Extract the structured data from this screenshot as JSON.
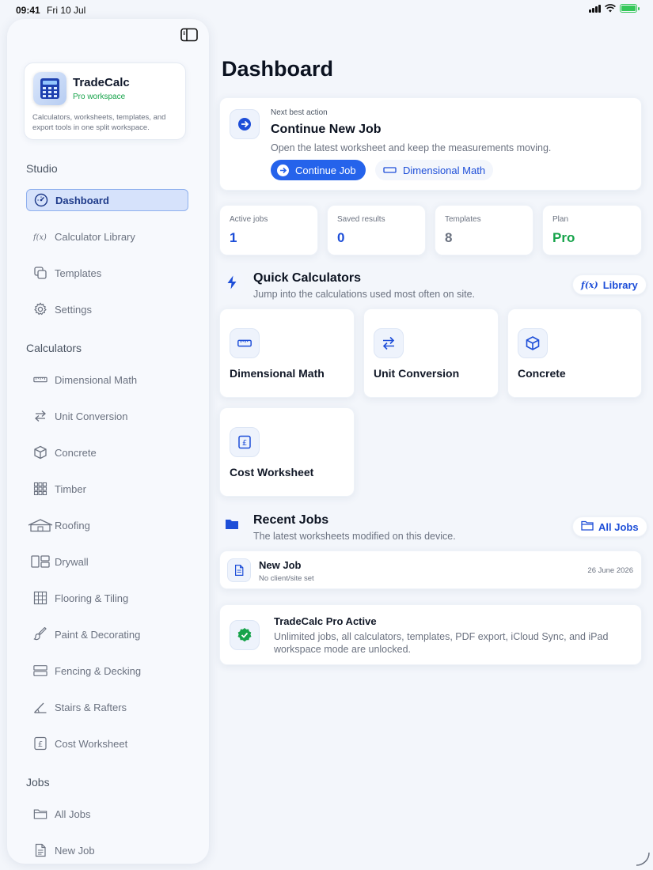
{
  "status": {
    "time": "09:41",
    "date": "Fri 10 Jul"
  },
  "sidebar": {
    "brand": {
      "name": "TradeCalc",
      "subtitle": "Pro workspace",
      "description": "Calculators, worksheets, templates, and export tools in one split workspace."
    },
    "sections": {
      "studio": "Studio",
      "calculators": "Calculators",
      "jobs": "Jobs"
    },
    "studio_items": [
      {
        "label": "Dashboard",
        "icon": "gauge-icon"
      },
      {
        "label": "Calculator Library",
        "icon": "function-icon"
      },
      {
        "label": "Templates",
        "icon": "copy-icon"
      },
      {
        "label": "Settings",
        "icon": "gear-icon"
      }
    ],
    "calculator_items": [
      {
        "label": "Dimensional Math",
        "icon": "ruler-icon"
      },
      {
        "label": "Unit Conversion",
        "icon": "swap-arrows-icon"
      },
      {
        "label": "Concrete",
        "icon": "cube-icon"
      },
      {
        "label": "Timber",
        "icon": "grid-dots-icon"
      },
      {
        "label": "Roofing",
        "icon": "house-icon"
      },
      {
        "label": "Drywall",
        "icon": "panels-icon"
      },
      {
        "label": "Flooring & Tiling",
        "icon": "tiles-icon"
      },
      {
        "label": "Paint & Decorating",
        "icon": "paint-brush-icon"
      },
      {
        "label": "Fencing & Decking",
        "icon": "boards-icon"
      },
      {
        "label": "Stairs & Rafters",
        "icon": "angle-icon"
      },
      {
        "label": "Cost Worksheet",
        "icon": "pound-icon"
      }
    ],
    "job_items": [
      {
        "label": "All Jobs",
        "icon": "folder-icon"
      },
      {
        "label": "New Job",
        "icon": "document-icon"
      }
    ]
  },
  "main": {
    "title": "Dashboard",
    "next_action": {
      "kicker": "Next best action",
      "title": "Continue New Job",
      "description": "Open the latest worksheet and keep the measurements moving.",
      "primary_label": "Continue Job",
      "secondary_label": "Dimensional Math"
    },
    "stats": [
      {
        "label": "Active jobs",
        "value": "1"
      },
      {
        "label": "Saved results",
        "value": "0"
      },
      {
        "label": "Templates",
        "value": "8"
      },
      {
        "label": "Plan",
        "value": "Pro"
      }
    ],
    "quick": {
      "title": "Quick Calculators",
      "subtitle": "Jump into the calculations used most often on site.",
      "library_label": "Library",
      "tiles": [
        {
          "label": "Dimensional Math",
          "icon": "ruler-icon"
        },
        {
          "label": "Unit Conversion",
          "icon": "swap-arrows-icon"
        },
        {
          "label": "Concrete",
          "icon": "cube-icon"
        },
        {
          "label": "Cost Worksheet",
          "icon": "pound-icon"
        }
      ]
    },
    "recent": {
      "title": "Recent Jobs",
      "subtitle": "The latest worksheets modified on this device.",
      "all_jobs_label": "All Jobs",
      "jobs": [
        {
          "name": "New Job",
          "client": "No client/site set",
          "date": "26 June 2026"
        }
      ]
    },
    "pro": {
      "title": "TradeCalc Pro Active",
      "description": "Unlimited jobs, all calculators, templates, PDF export, iCloud Sync, and iPad workspace mode are unlocked."
    }
  },
  "colors": {
    "accent": "#2563eb",
    "success": "#16a34a",
    "background": "#f3f6fb"
  }
}
